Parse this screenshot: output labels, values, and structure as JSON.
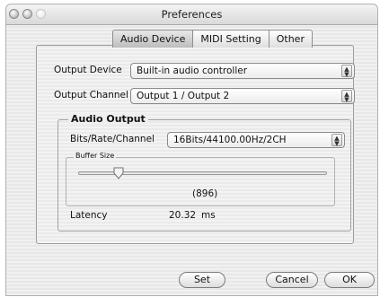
{
  "window": {
    "title": "Preferences"
  },
  "tabs": [
    {
      "label": "Audio Device",
      "active": true
    },
    {
      "label": "MIDI Setting",
      "active": false
    },
    {
      "label": "Other",
      "active": false
    }
  ],
  "output_device": {
    "label": "Output Device",
    "value": "Built-in audio controller"
  },
  "output_channel": {
    "label": "Output Channel",
    "value": "Output 1 / Output 2"
  },
  "audio_output": {
    "title": "Audio Output",
    "bits_rate_channel": {
      "label": "Bits/Rate/Channel",
      "value": "16Bits/44100.00Hz/2CH"
    },
    "buffer_size": {
      "title": "Buffer Size",
      "value": "(896)"
    },
    "latency": {
      "label": "Latency",
      "value": "20.32",
      "unit": "ms"
    }
  },
  "buttons": {
    "set": "Set",
    "cancel": "Cancel",
    "ok": "OK"
  },
  "icons": {
    "popup_arrows": "updown-arrows-icon",
    "slider_thumb": "slider-thumb-icon"
  }
}
